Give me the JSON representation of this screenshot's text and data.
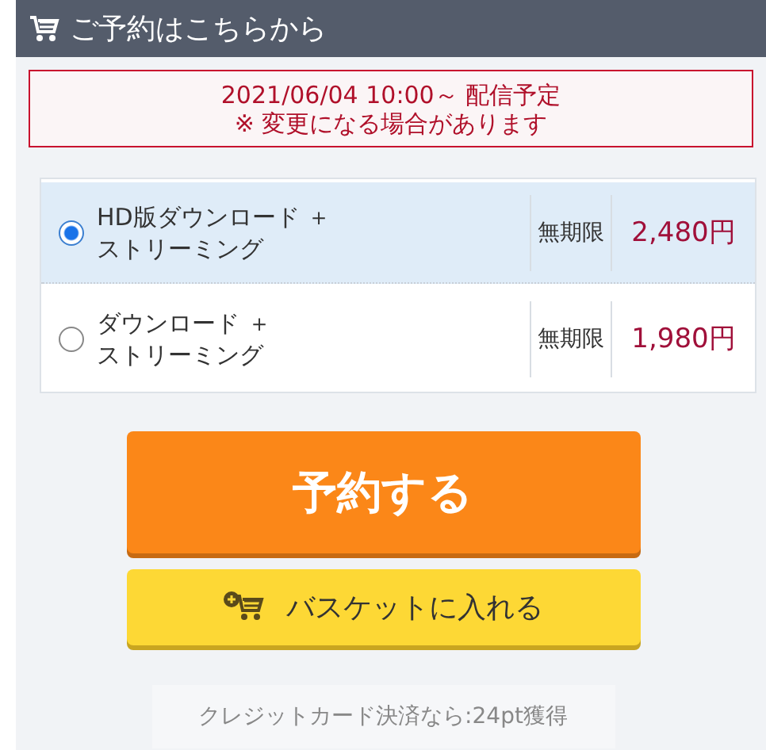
{
  "header": {
    "title": "ご予約はこちらから"
  },
  "notice": {
    "lines": [
      "2021/06/04 10:00～ 配信予定",
      "※ 変更になる場合があります"
    ]
  },
  "options": [
    {
      "name_lines": [
        "HD版ダウンロード ＋",
        "ストリーミング"
      ],
      "period": "無期限",
      "price": "2,480円",
      "selected": true
    },
    {
      "name_lines": [
        "ダウンロード ＋",
        "ストリーミング"
      ],
      "period": "無期限",
      "price": "1,980円",
      "selected": false
    }
  ],
  "buttons": {
    "reserve": "予約する",
    "basket": "バスケットに入れる"
  },
  "points_note": "クレジットカード決済なら:24pt獲得"
}
